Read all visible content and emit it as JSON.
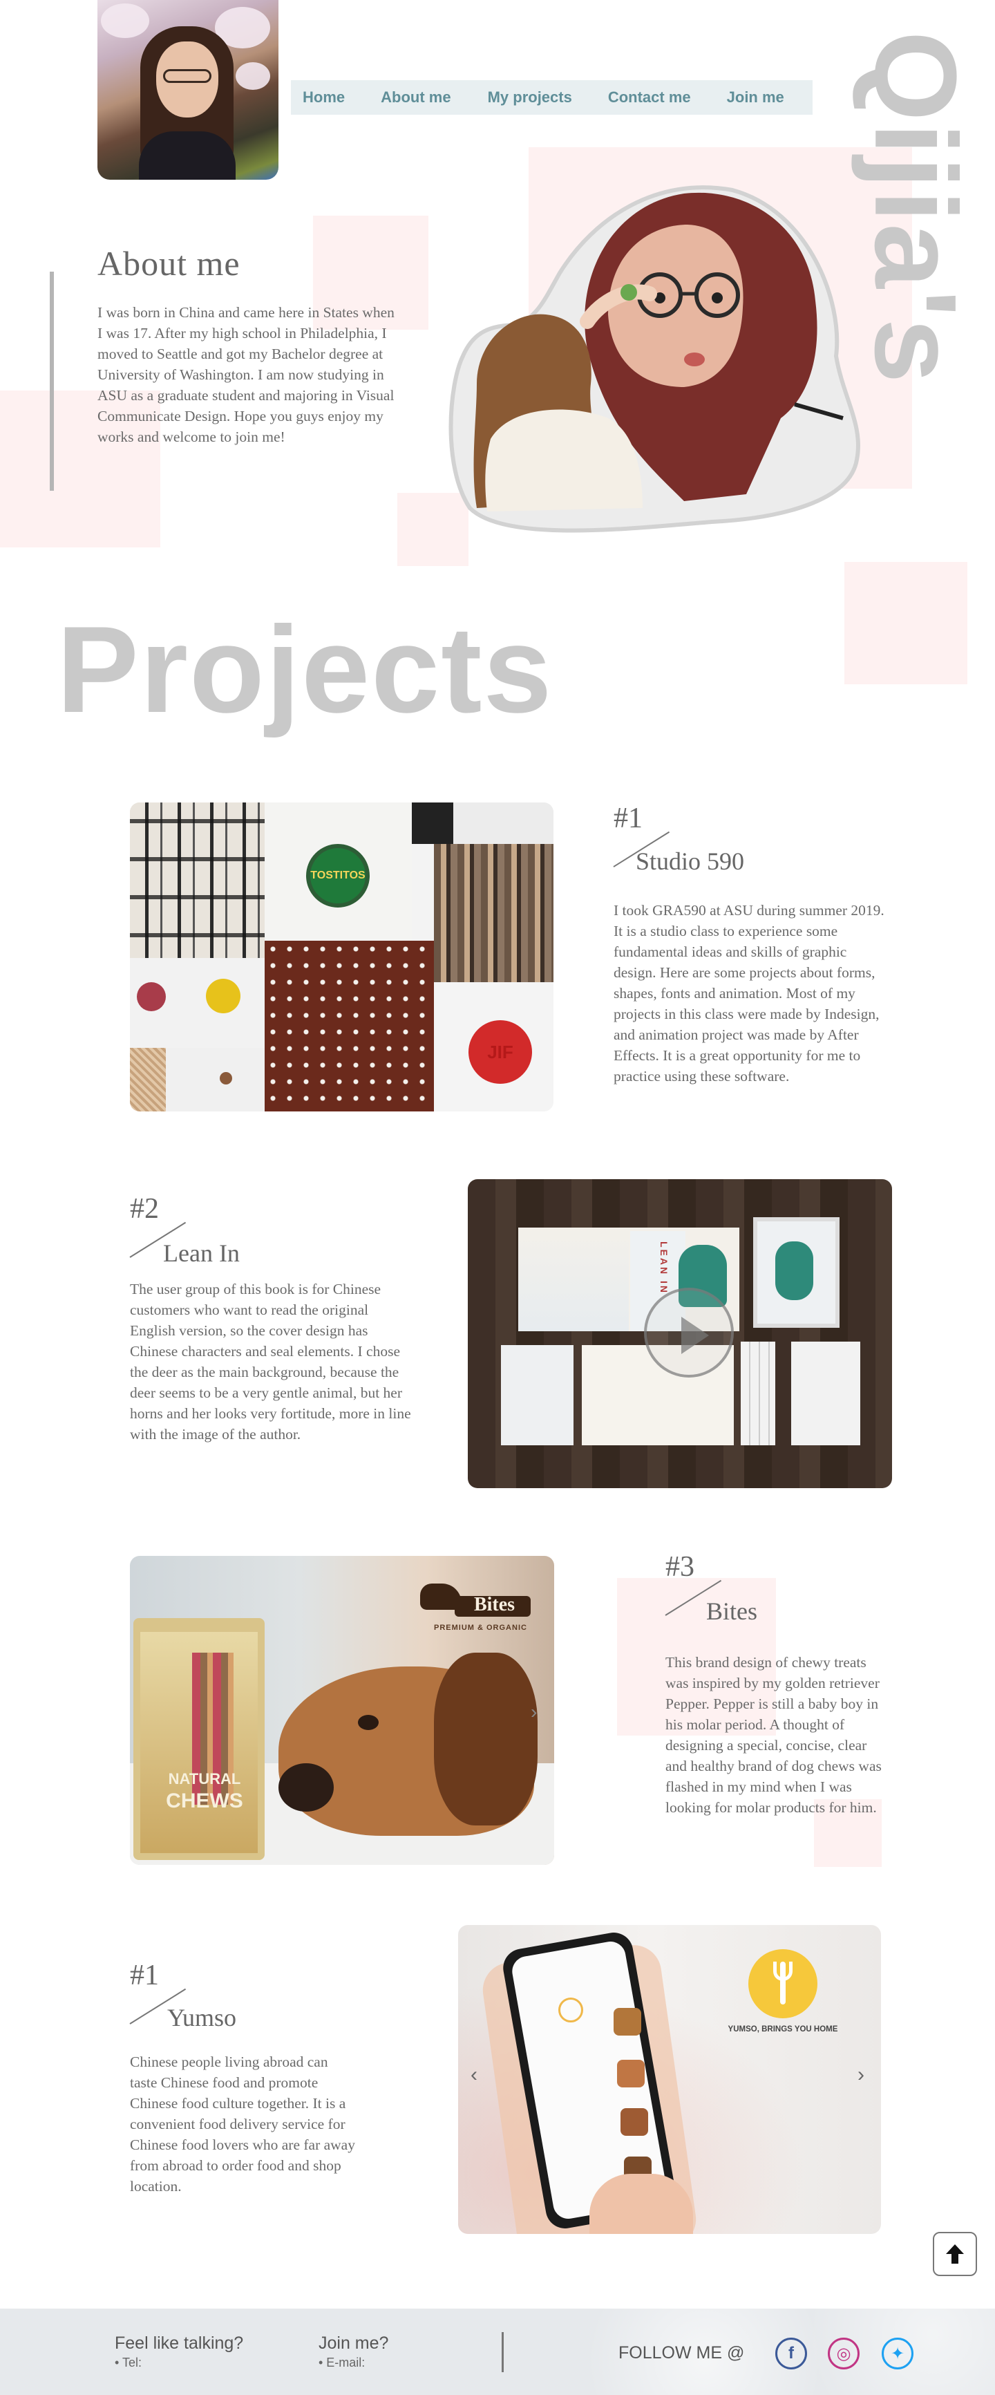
{
  "nav": {
    "items": [
      {
        "label": "Home"
      },
      {
        "label": "About me"
      },
      {
        "label": "My projects"
      },
      {
        "label": "Contact me"
      },
      {
        "label": "Join me"
      }
    ]
  },
  "brand": {
    "vertical_name": "Qijia's"
  },
  "about": {
    "title": "About me",
    "text": "I was born in China and came here in States when I was 17. After my high school in Philadelphia, I moved to Seattle and got my Bachelor degree at University of Washington. I am now studying in ASU as a graduate student and majoring in Visual Communicate Design. Hope you guys enjoy my works and welcome to join me!"
  },
  "projects": {
    "title": "Projects",
    "items": [
      {
        "number": "#1",
        "name": "Studio 590",
        "text": "I took GRA590 at ASU during summer 2019. It is a studio class to experience some fundamental  ideas and skills of graphic design. Here are some projects about forms, shapes, fonts and animation. Most of my projects in this class were made by Indesign, and animation project was made by After Effects. It is a great opportunity for me to practice using these software.",
        "image_text": [
          "TOSTITOS",
          "JIF"
        ]
      },
      {
        "number": "#2",
        "name": "Lean In",
        "text": "The user group of this book is for Chinese customers who want to read the original English version, so the cover design has Chinese characters and seal elements. I chose the deer as the main background, because the deer seems to be a very gentle animal, but her horns and her looks very fortitude, more in line with the image of the author.",
        "image_text": [
          "LEAN IN"
        ]
      },
      {
        "number": "#3",
        "name": "Bites",
        "text": "This brand design of chewy treats was inspired by my golden retriever Pepper. Pepper is still a baby boy in his molar period. A thought of designing a special, concise, clear and healthy brand of dog chews was flashed in my mind when I was looking for molar products for him.",
        "image_text": [
          "Bites",
          "PREMIUM & ORGANIC",
          "NATURAL",
          "CHEWS"
        ]
      },
      {
        "number": "#1",
        "name": "Yumso",
        "text": "Chinese people living abroad can taste Chinese food and promote Chinese food culture together. It is a convenient food delivery service for Chinese food lovers who are far away from abroad to order food and shop location.",
        "image_text": [
          "YUMSO, BRINGS YOU HOME"
        ]
      }
    ]
  },
  "footer": {
    "talk_label": "Feel like talking?",
    "talk_sub": "• Tel:",
    "join_label": "Join me?",
    "join_sub": "• E-mail:",
    "follow_label": "FOLLOW ME @",
    "socials": [
      {
        "icon": "facebook-icon",
        "glyph": "f",
        "color": "#3b5998"
      },
      {
        "icon": "instagram-icon",
        "glyph": "◎",
        "color": "#c13584"
      },
      {
        "icon": "twitter-icon",
        "glyph": "✦",
        "color": "#1da1f2"
      }
    ]
  },
  "colors": {
    "nav_text": "#5f8e98",
    "nav_bg": "#e8eff1",
    "accent_pink": "#fdecec",
    "heading_gray": "#c9c9c9"
  }
}
